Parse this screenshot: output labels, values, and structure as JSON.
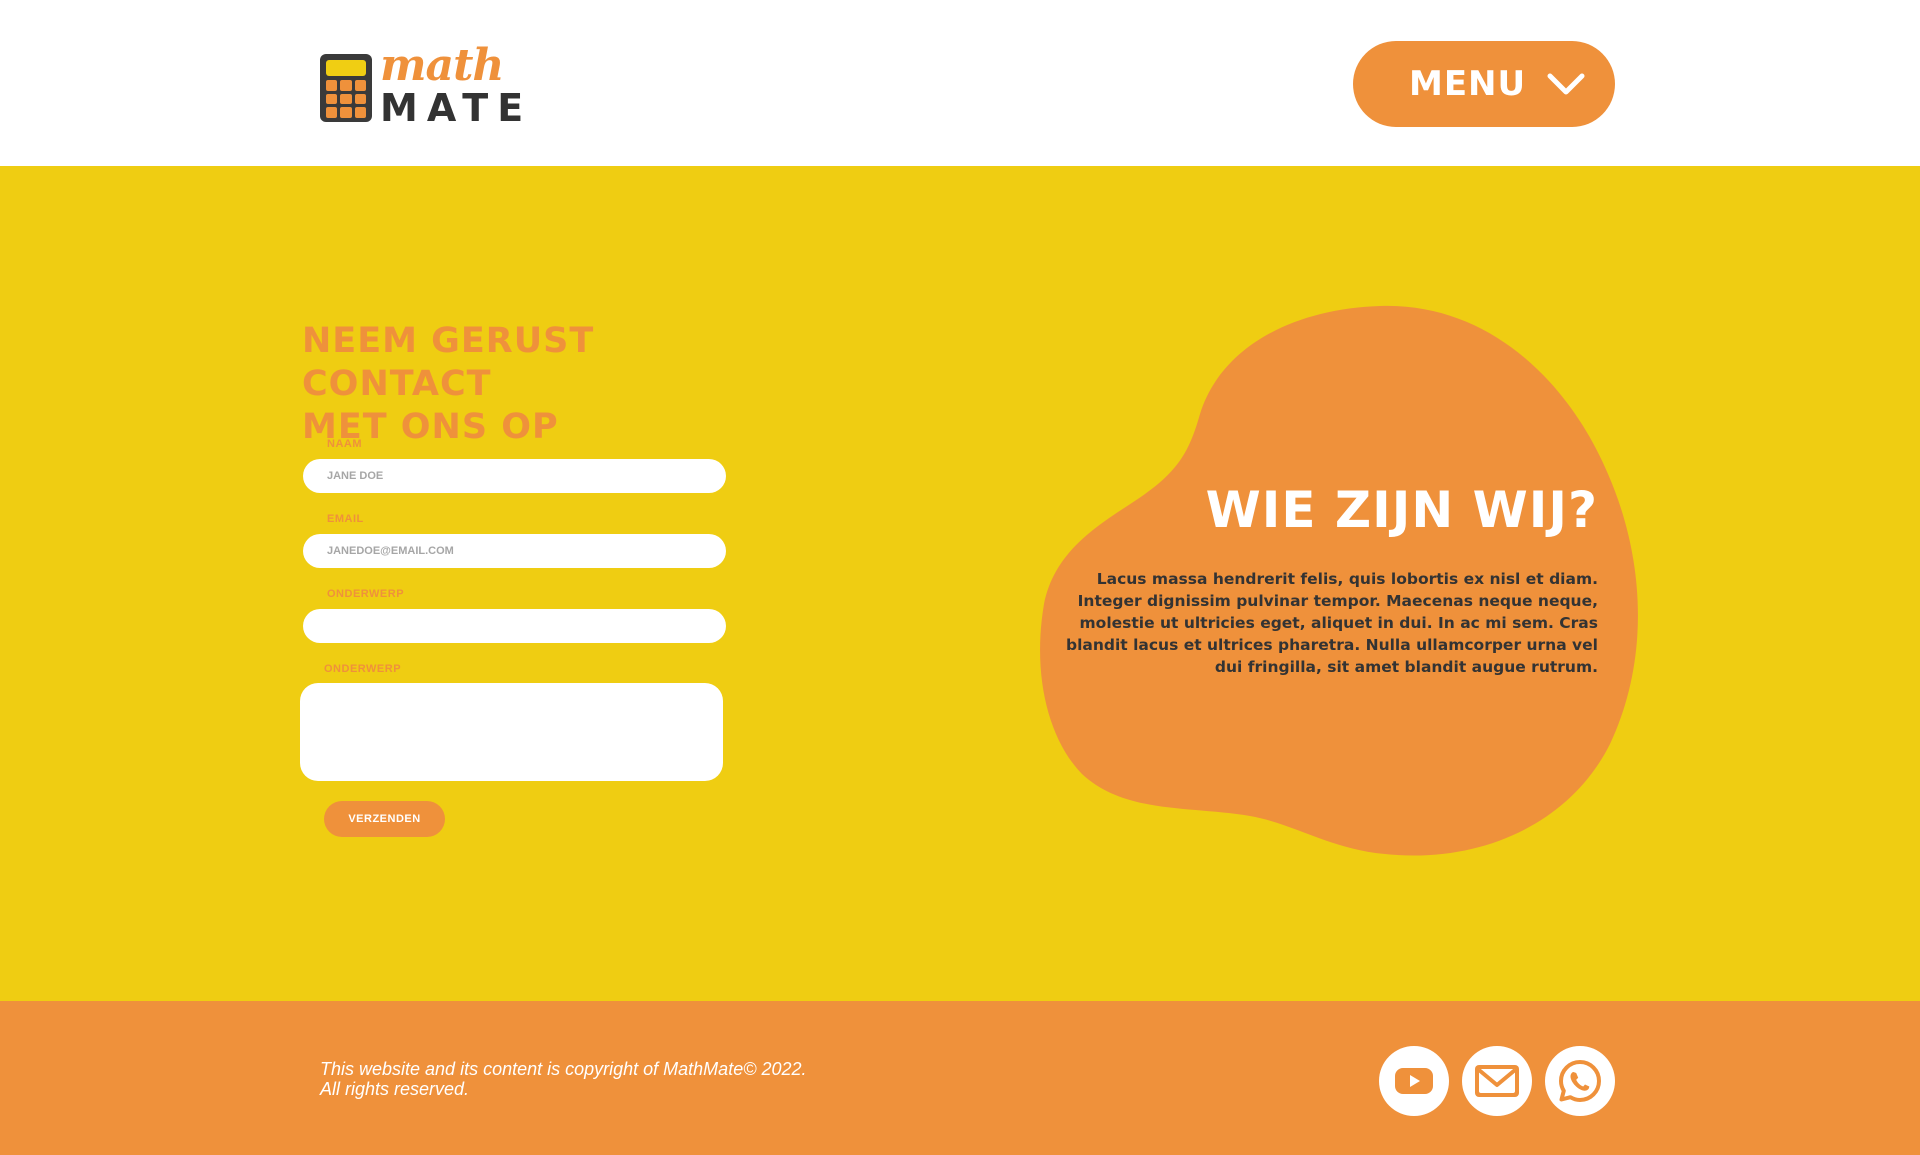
{
  "colors": {
    "accent_orange": "#ef913b",
    "yellow_background": "#efcd12",
    "dark_text": "#333333",
    "white": "#ffffff"
  },
  "header": {
    "logo": {
      "word_top": "math",
      "word_bottom": "MATE",
      "icon": "calculator-icon"
    },
    "menu": {
      "label": "MENU",
      "icon": "chevron-down-icon"
    }
  },
  "contact": {
    "title_line1": "NEEM GERUST CONTACT",
    "title_line2": "MET ONS OP",
    "fields": {
      "name": {
        "label": "NAAM",
        "placeholder": "JANE DOE"
      },
      "email": {
        "label": "EMAIL",
        "placeholder": "JANEDOE@EMAIL.COM"
      },
      "subject": {
        "label": "ONDERWERP",
        "placeholder": ""
      },
      "message": {
        "label": "ONDERWERP"
      }
    },
    "submit_label": "VERZENDEN"
  },
  "about": {
    "title": "WIE ZIJN WIJ?",
    "text": "Lacus massa hendrerit felis, quis lobortis ex nisl et diam. Integer dignissim pulvinar tempor. Maecenas neque neque, molestie ut ultricies eget, aliquet in dui. In ac mi sem. Cras blandit lacus et ultrices pharetra. Nulla ullamcorper urna vel dui fringilla, sit amet blandit augue rutrum."
  },
  "footer": {
    "copyright_line1": "This website and its content is copyright of MathMate© 2022.",
    "copyright_line2": "All rights reserved.",
    "social": [
      {
        "name": "youtube",
        "icon": "youtube-icon"
      },
      {
        "name": "email",
        "icon": "mail-icon"
      },
      {
        "name": "whatsapp",
        "icon": "whatsapp-icon"
      }
    ]
  }
}
